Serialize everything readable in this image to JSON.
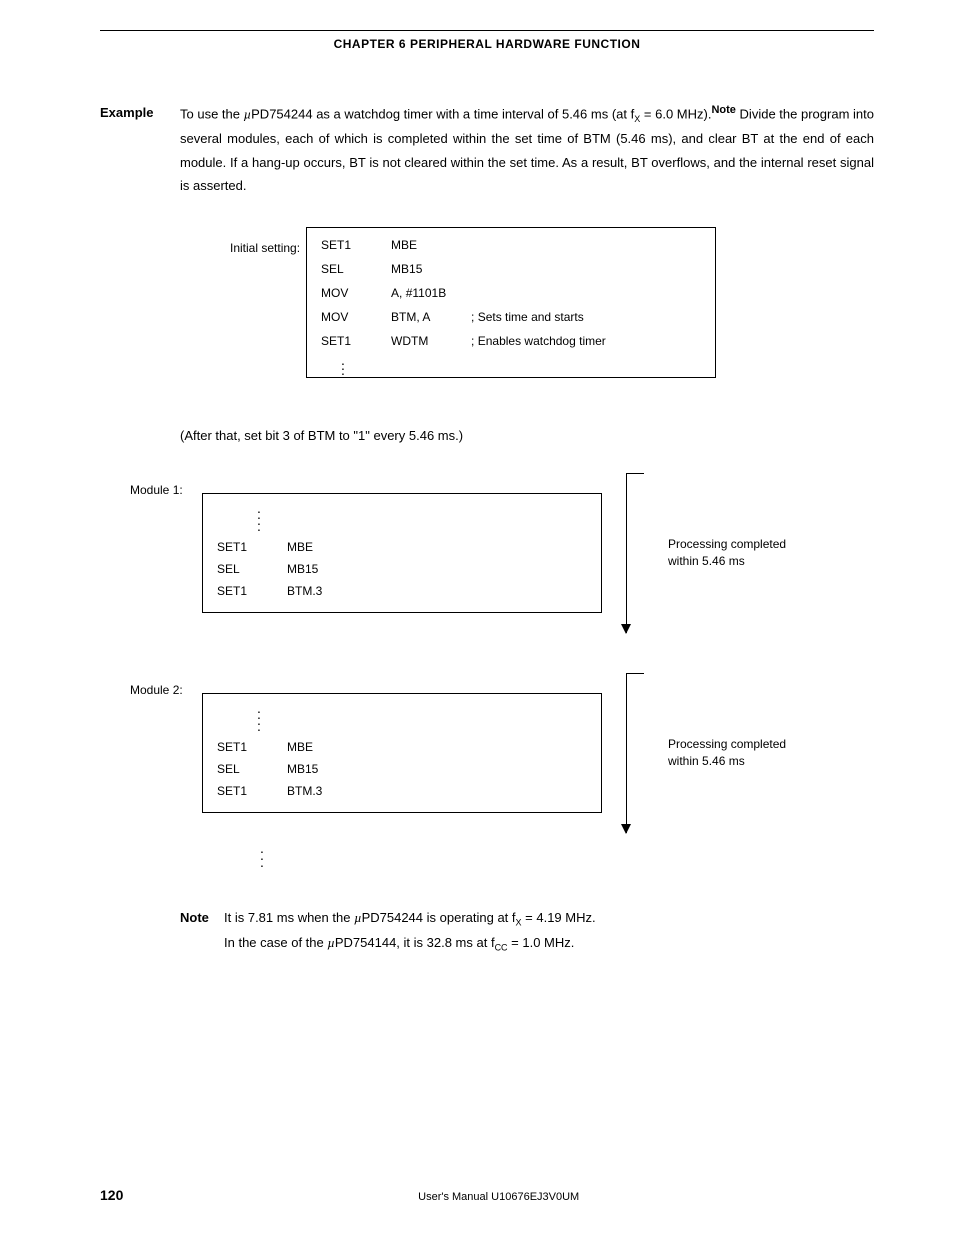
{
  "header": {
    "chapter": "CHAPTER 6   PERIPHERAL HARDWARE FUNCTION"
  },
  "example": {
    "label": "Example",
    "text_a": "To use the ",
    "mu": "µ",
    "text_b": "PD754244 as a watchdog timer with a time interval of 5.46 ms (at f",
    "sub_x1": "X",
    "text_c": " = 6.0 MHz).",
    "note_sup": "Note",
    "para2": "Divide the program into several modules, each of which is completed within the set time of BTM (5.46 ms), and clear BT at the end of each module.  If a hang-up occurs, BT is not cleared within the set time.  As a result, BT overflows, and the internal reset signal is asserted."
  },
  "initial": {
    "label": "Initial setting:",
    "rows": [
      {
        "a": "SET1",
        "b": "MBE",
        "c": ""
      },
      {
        "a": "SEL",
        "b": "MB15",
        "c": ""
      },
      {
        "a": "MOV",
        "b": "A, #1101B",
        "c": ""
      },
      {
        "a": "MOV",
        "b": "BTM, A",
        "c": "; Sets time and starts"
      },
      {
        "a": "SET1",
        "b": "WDTM",
        "c": "; Enables watchdog timer"
      }
    ]
  },
  "after_text": "(After that, set bit 3 of BTM to \"1\" every 5.46 ms.)",
  "modules": [
    {
      "label": "Module 1:",
      "rows": [
        {
          "a": "SET1",
          "b": "MBE"
        },
        {
          "a": "SEL",
          "b": "MB15"
        },
        {
          "a": "SET1",
          "b": "BTM.3"
        }
      ],
      "proc_line1": "Processing completed",
      "proc_line2": "within 5.46 ms"
    },
    {
      "label": "Module 2:",
      "rows": [
        {
          "a": "SET1",
          "b": "MBE"
        },
        {
          "a": "SEL",
          "b": "MB15"
        },
        {
          "a": "SET1",
          "b": "BTM.3"
        }
      ],
      "proc_line1": "Processing completed",
      "proc_line2": "within 5.46 ms"
    }
  ],
  "note": {
    "label": "Note",
    "line1_a": "It is 7.81 ms when the ",
    "line1_b": "PD754244 is operating at f",
    "line1_sub": "X",
    "line1_c": " = 4.19 MHz.",
    "line2_a": "In the case of the ",
    "line2_b": "PD754144, it is 32.8 ms at f",
    "line2_sub": "CC",
    "line2_c": " = 1.0 MHz."
  },
  "footer": {
    "page": "120",
    "center": "User's Manual  U10676EJ3V0UM"
  }
}
